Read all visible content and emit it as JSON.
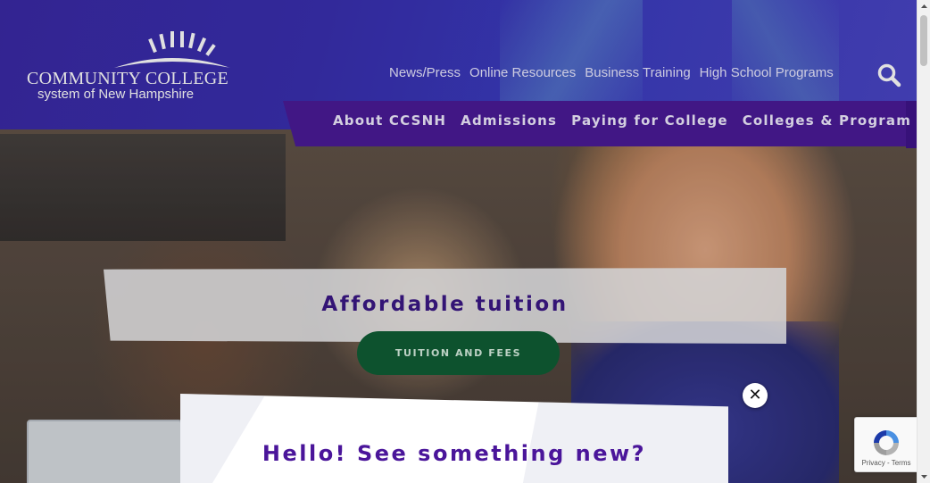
{
  "logo": {
    "line1": "COMMUNITY COLLEGE",
    "line2": "system of New Hampshire"
  },
  "top_links": [
    "News/Press",
    "Online Resources",
    "Business Training",
    "High School Programs"
  ],
  "search": {
    "icon": "search-icon"
  },
  "main_nav": [
    "About CCSNH",
    "Admissions",
    "Paying for College",
    "Colleges & Programs"
  ],
  "slide": {
    "title": "Affordable tuition",
    "cta": "TUITION AND FEES"
  },
  "modal": {
    "title": "Hello! See something new?",
    "close_glyph": "✕"
  },
  "recaptcha": {
    "links": "Privacy - Terms"
  },
  "colors": {
    "primary_purple": "#4a1b98",
    "header_blue": "#3b2aa6",
    "cta_green": "#0f5e35",
    "title_purple": "#3b1786"
  }
}
